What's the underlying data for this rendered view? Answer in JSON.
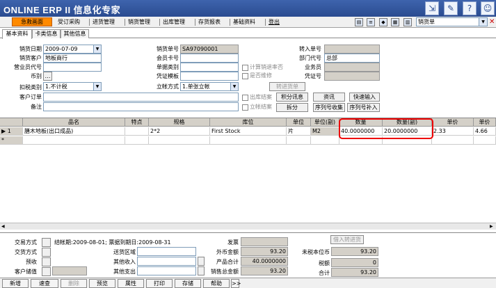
{
  "app": {
    "title": "ONLINE ERP II 信息化专家"
  },
  "menu": {
    "items": [
      "急救画面",
      "受订采购",
      "进货管理",
      "销货管理",
      "出库管理",
      "存货报表",
      "基础资料",
      "登出"
    ],
    "doc_type": "销货单"
  },
  "tabs": [
    "基本资料",
    "卡类信息",
    "其他信息"
  ],
  "form": {
    "sale_date_label": "销货日期",
    "sale_date": "2009-07-09",
    "customer_label": "销货客户",
    "customer": "地板商行",
    "salesperson_label": "营业员代号",
    "salesperson": "",
    "currency_label": "币别",
    "currency": "",
    "tax_label": "扣税类别",
    "tax": "1.不计税",
    "order_label": "客户订单",
    "order": "",
    "remark_label": "备注",
    "remark": "",
    "sale_no_label": "销货单号",
    "sale_no": "SA97090001",
    "member_label": "会员卡号",
    "member": "",
    "doc_cat_label": "单据类别",
    "doc_cat": "",
    "cert_label": "凭证模板",
    "cert": "",
    "account_label": "立帐方式",
    "account": "1.单张立帐",
    "transfer_label": "转入单号",
    "transfer": "",
    "dept_label": "部门代号",
    "dept": "总部",
    "biz_label": "业务员",
    "biz": "",
    "voucher_label": "凭证号",
    "voucher": "",
    "chk_calc": "计算销退率否",
    "chk_maint": "是否维修",
    "chk_out": "出库结案",
    "chk_close": "立帐结案",
    "btn_transfer": "转进货单",
    "btn_points": "积分讯息",
    "btn_info": "资讯",
    "btn_quick": "快速输入",
    "btn_split": "拆分",
    "btn_serial_collect": "序列号收集",
    "btn_serial_add": "序列号补入"
  },
  "grid": {
    "headers": [
      "品名",
      "特点",
      "规格",
      "库位",
      "单位",
      "单位(副)",
      "数量",
      "数量(副)",
      "单价",
      "单价"
    ],
    "rows": [
      {
        "indicator": "▶ 1",
        "name": "膳木地板(出口成品)",
        "feature": "",
        "spec": "2*2",
        "stock": "First Stock",
        "unit": "片",
        "unit2": "M2",
        "qty": "40.0000000",
        "qty2": "20.0000000",
        "price": "2.33",
        "price2": "4.66"
      }
    ],
    "new_row": "*"
  },
  "bottom": {
    "trade_label": "交易方式",
    "settle_text": "结帐期:2009-08-01; 票据到期日:2009-08-31",
    "ship_label": "交货方式",
    "ship_area_label": "送货区域",
    "ship_area": "",
    "prepay_label": "预收",
    "other_in_label": "其他收入",
    "other_in": "",
    "deposit_label": "客户储值",
    "other_out_label": "其他支出",
    "other_out": "",
    "invoice_label": "发票",
    "invoice": "",
    "foreign_total_label": "外币金额",
    "foreign_total": "93.20",
    "product_total_label": "产品合计",
    "product_total": "40.0000000",
    "sale_total_label": "销售总金额",
    "sale_total": "93.20",
    "untaxed_label": "未税本位币",
    "untaxed": "93.20",
    "tax_amount_label": "税额",
    "tax_amount": "0",
    "total_label": "合计",
    "total": "93.20",
    "btn_borrow": "借入转进货"
  },
  "buttons": [
    "新增",
    "速查",
    "删除",
    "预览",
    "属性",
    "打印",
    "存储",
    "帮助",
    ">>"
  ]
}
